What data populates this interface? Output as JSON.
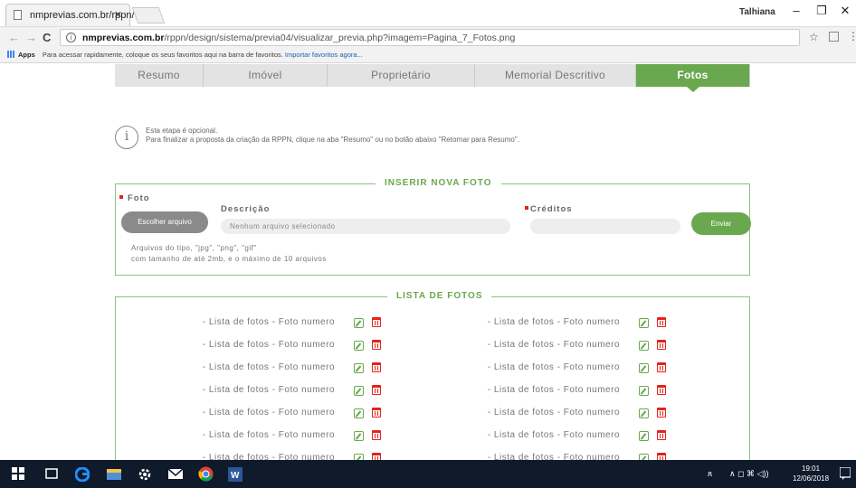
{
  "browser": {
    "tab_title": "nmprevias.com.br/rppn/",
    "tab_close": "✕",
    "user_name": "Talhiana",
    "window_controls": {
      "minimize": "–",
      "maximize": "❐",
      "close": "✕"
    },
    "url_host": "nmprevias.com.br",
    "url_path": "/rppn/design/sistema/previa04/visualizar_previa.php?imagem=Pagina_7_Fotos.png",
    "nav": {
      "back": "←",
      "forward": "→",
      "reload": "C"
    },
    "star": "☆",
    "menu": "⋮",
    "bookmarks": {
      "apps_label": "Apps",
      "prompt": "Para acessar rapidamente, coloque os seus favoritos aqui na barra de favoritos.",
      "import_link": "Importar favoritos agora..."
    }
  },
  "tabs": [
    {
      "label": "Resumo",
      "active": false
    },
    {
      "label": "Imóvel",
      "active": false
    },
    {
      "label": "Proprietário",
      "active": false
    },
    {
      "label": "Memorial Descritivo",
      "active": false
    },
    {
      "label": "Fotos",
      "active": true
    }
  ],
  "notice": {
    "icon": "i",
    "line1": "Esta etapa é opcional.",
    "line2": "Para finalizar a proposta da criação da RPPN, clique na aba \"Resumo\" ou no botão abaixo \"Retornar para Resumo\"."
  },
  "insert_panel": {
    "title": "INSERIR NOVA FOTO",
    "foto_label": "Foto",
    "file_button": "Escolher arquivo",
    "description_label": "Descrição",
    "description_value": "Nenhum arquivo selecionado",
    "credits_label": "Créditos",
    "send_button": "Enviar",
    "hint_line1": "Arquivos do tipo, \"jpg\", \"png\", \"gif\"",
    "hint_line2": "com tamanho de até 2mb, e o máximo de 10 arquivos"
  },
  "photo_list": {
    "title": "LISTA DE FOTOS",
    "left": [
      "- Lista de fotos - Foto numero",
      "- Lista de fotos - Foto numero",
      "- Lista de fotos - Foto numero",
      "- Lista de fotos - Foto numero",
      "- Lista de fotos - Foto numero",
      "- Lista de fotos - Foto numero",
      "- Lista de fotos - Foto numero"
    ],
    "right": [
      "- Lista de fotos - Foto numero",
      "- Lista de fotos - Foto numero",
      "- Lista de fotos - Foto numero",
      "- Lista de fotos - Foto numero",
      "- Lista de fotos - Foto numero",
      "- Lista de fotos - Foto numero",
      "- Lista de fotos - Foto numero"
    ]
  },
  "taskbar": {
    "clock_time": "19:01",
    "clock_date": "12/06/2018",
    "tray_text": "∧ ◻ ⌘ ◁))"
  },
  "colors": {
    "accent": "#6aa84f",
    "required": "#e2231a",
    "taskbar": "#0f1a2b"
  }
}
